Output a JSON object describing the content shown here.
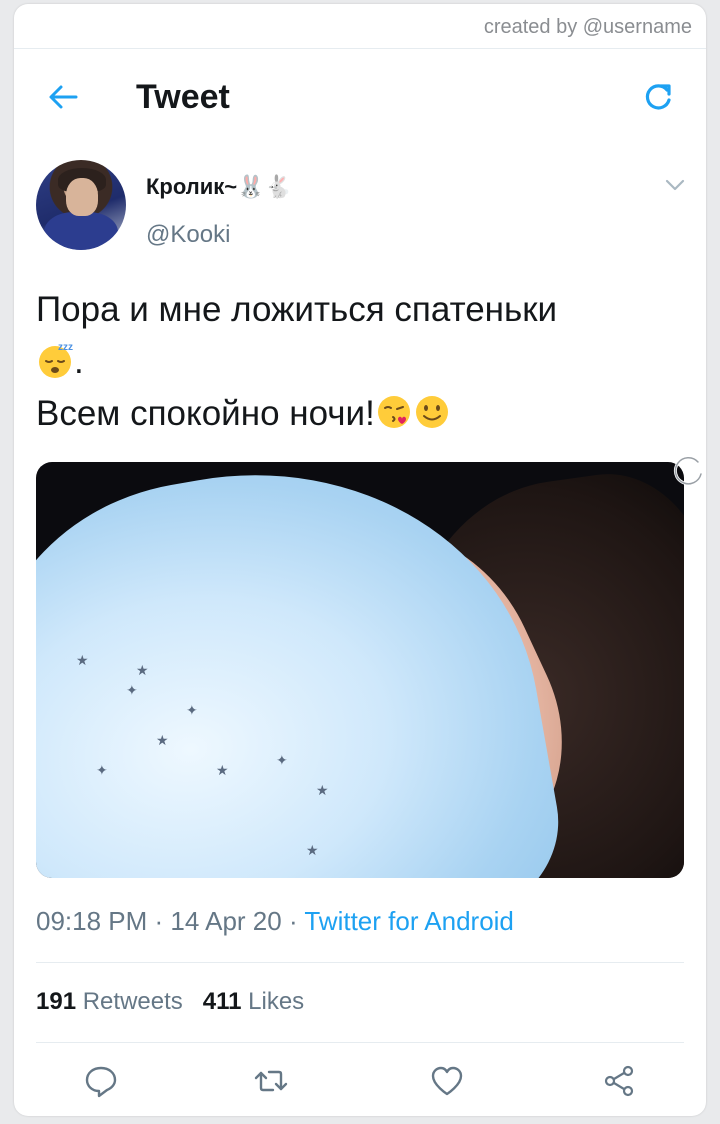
{
  "watermark": "created by @username",
  "header": {
    "title": "Tweet"
  },
  "author": {
    "display_name": "Кролик~",
    "name_emoji": "🐰🐇",
    "handle": "@Kooki"
  },
  "tweet": {
    "line1": "Пора и мне ложиться спатеньки",
    "line2_suffix": ".",
    "line3": "Всем спокойно ночи!"
  },
  "meta": {
    "time": "09:18 PM",
    "sep1": " · ",
    "date": "14 Apr 20",
    "sep2": " · ",
    "source": "Twitter for Android"
  },
  "stats": {
    "retweets_count": "191",
    "retweets_label": "Retweets",
    "likes_count": "411",
    "likes_label": "Likes"
  },
  "colors": {
    "accent": "#1da1f2",
    "secondary_text": "#657786",
    "primary_text": "#14171a"
  },
  "icons": [
    "back-arrow-icon",
    "refresh-icon",
    "chevron-down-icon",
    "sleeping-face-emoji",
    "kiss-face-emoji",
    "smile-face-emoji",
    "reply-icon",
    "retweet-icon",
    "like-icon",
    "share-icon"
  ]
}
